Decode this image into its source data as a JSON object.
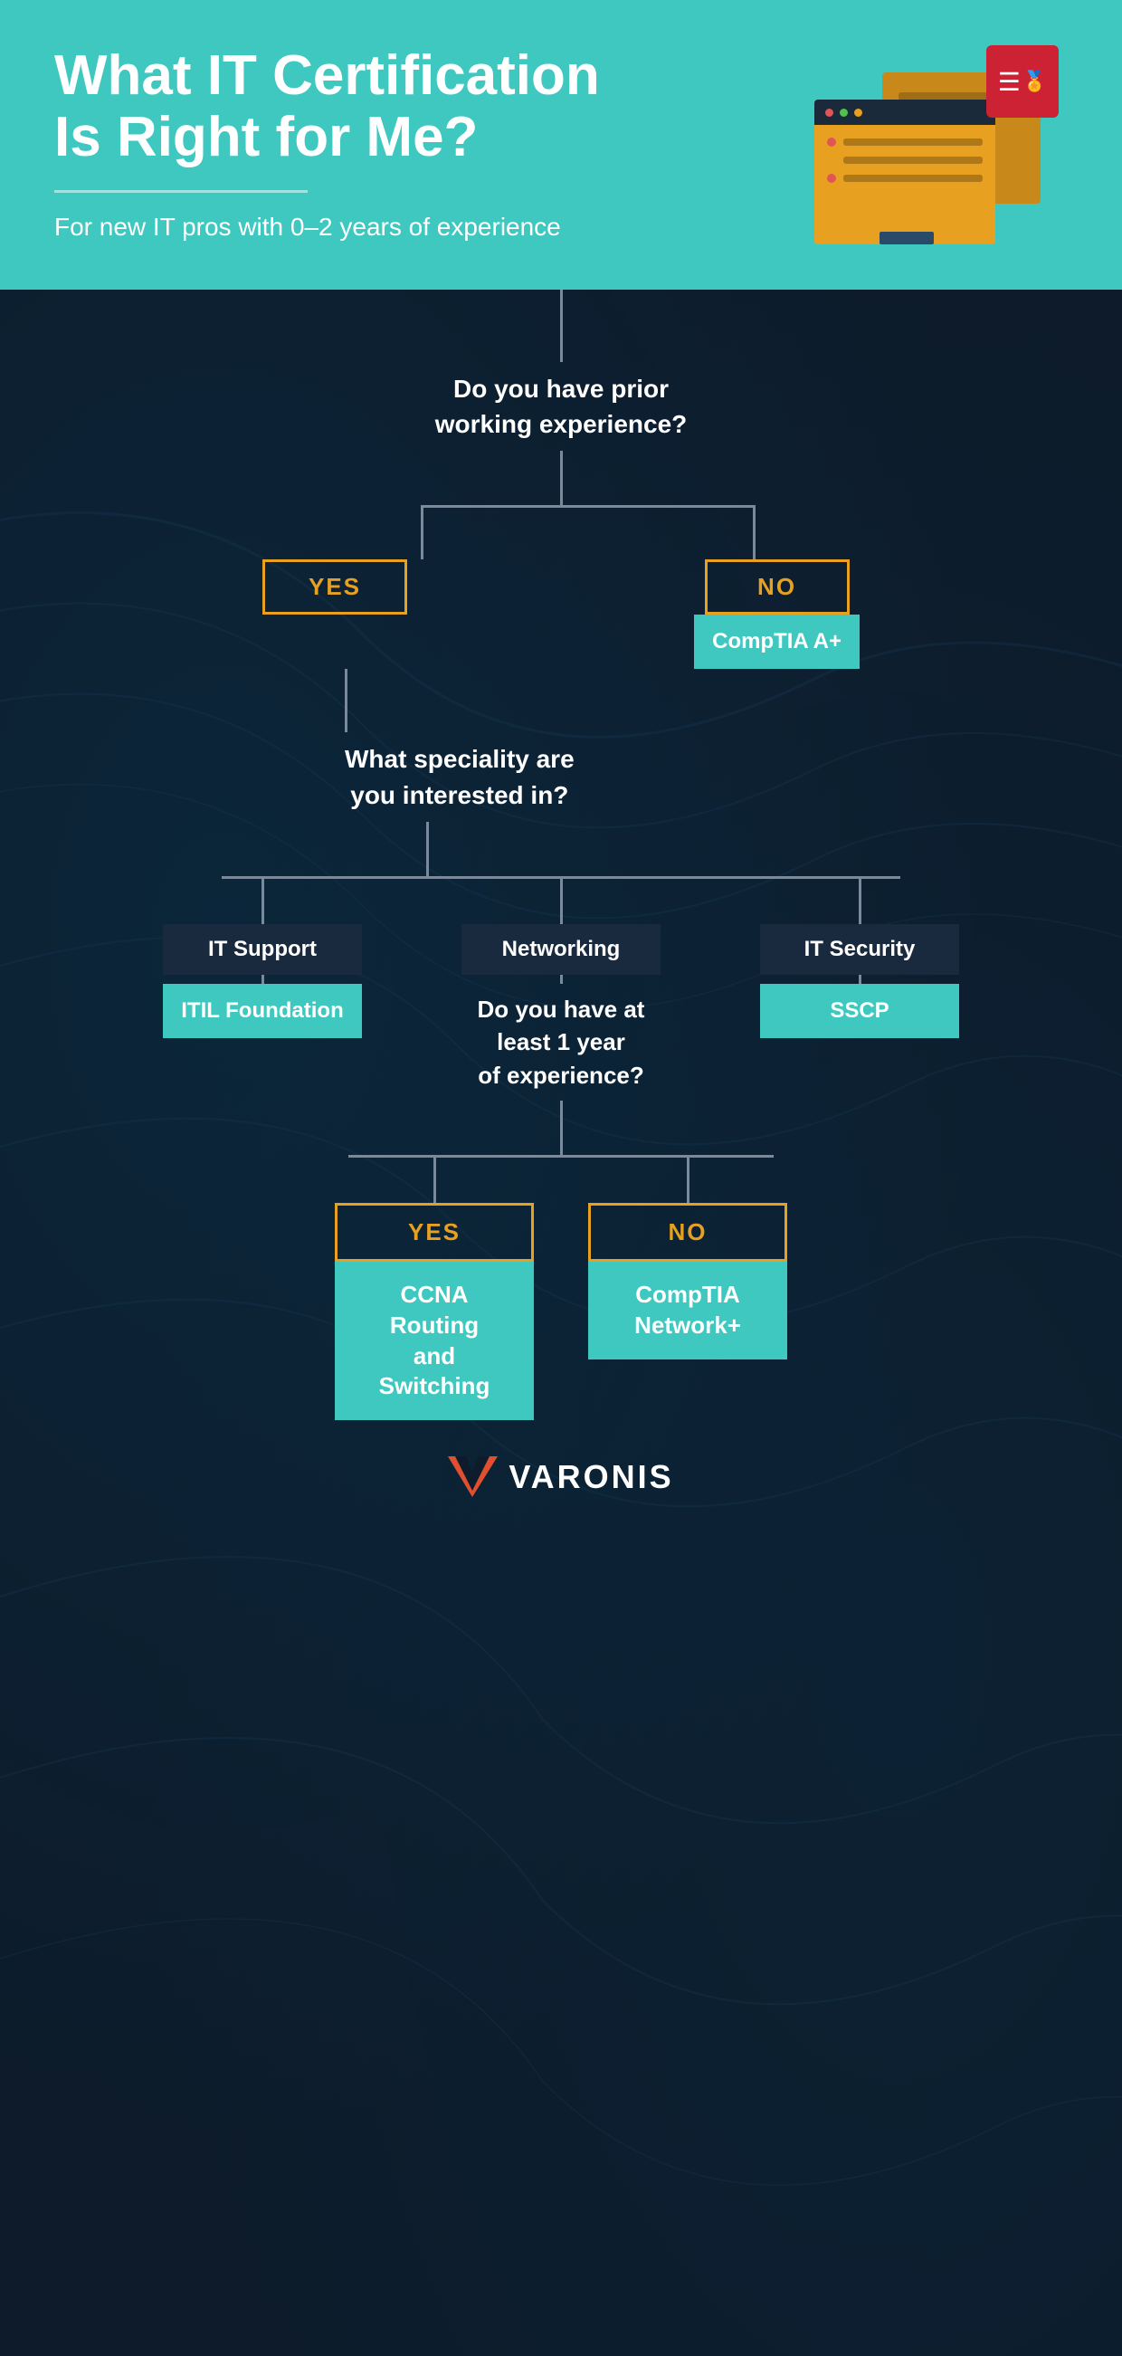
{
  "header": {
    "title_line1": "What IT Certification",
    "title_line2": "Is Right for Me?",
    "subtitle": "For new IT pros with 0–2 years of experience",
    "bg_color": "#3ec8c0"
  },
  "flowchart": {
    "q1": {
      "text": "Do you have prior\nworking experience?"
    },
    "yes_label": "YES",
    "no_label": "NO",
    "no_cert": "CompTIA A+",
    "q2": {
      "text": "What speciality are\nyou interested in?"
    },
    "branches": [
      {
        "category": "IT Support",
        "cert": "ITIL Foundation"
      },
      {
        "category": "Networking",
        "cert_question": "Do you have at\nleast 1 year\nof experience?"
      },
      {
        "category": "IT Security",
        "cert": "SSCP"
      }
    ],
    "networking_yes_cert": "CCNA Routing\nand Switching",
    "networking_no_cert": "CompTIA\nNetwork+"
  },
  "logo": {
    "text": "VARONIS"
  },
  "colors": {
    "teal": "#3ec8c0",
    "orange": "#e8a020",
    "dark_bg": "#0d1b2a",
    "navy": "#1a2a3e",
    "red": "#e05030",
    "connector": "#7a8a9a",
    "white": "#ffffff"
  }
}
